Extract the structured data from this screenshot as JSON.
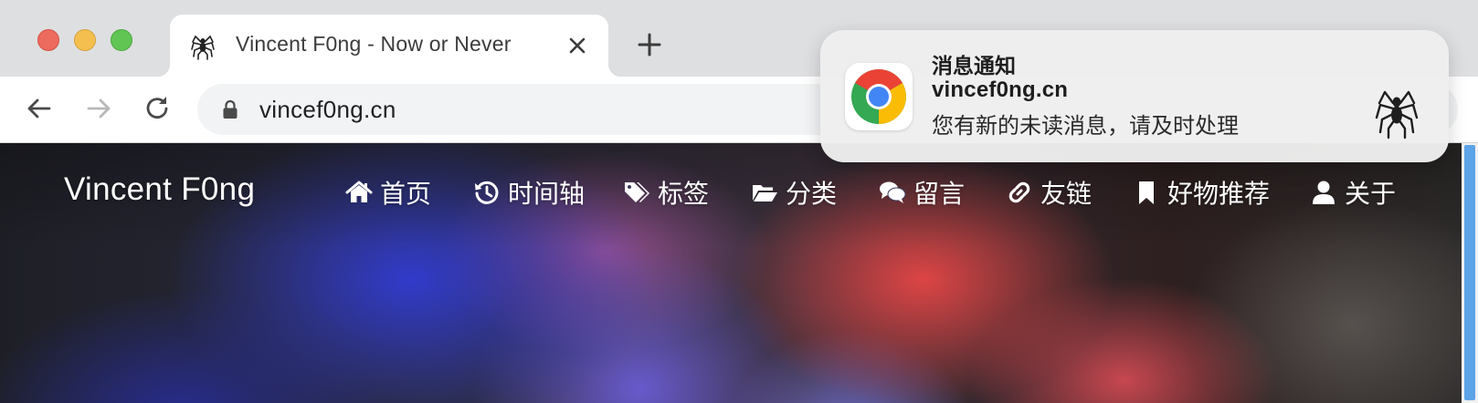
{
  "browser": {
    "tab": {
      "title": "Vincent F0ng - Now or Never",
      "favicon": "spider-icon"
    },
    "url": "vincef0ng.cn",
    "icons": {
      "back": "arrow-left-icon",
      "forward": "arrow-right-icon",
      "reload": "reload-icon",
      "lock": "lock-icon",
      "close": "close-icon",
      "new_tab": "plus-icon"
    }
  },
  "site": {
    "brand": "Vincent F0ng",
    "nav": [
      {
        "label": "首页",
        "icon": "home-icon"
      },
      {
        "label": "时间轴",
        "icon": "history-icon"
      },
      {
        "label": "标签",
        "icon": "tags-icon"
      },
      {
        "label": "分类",
        "icon": "folder-open-icon"
      },
      {
        "label": "留言",
        "icon": "comments-icon"
      },
      {
        "label": "友链",
        "icon": "link-icon"
      },
      {
        "label": "好物推荐",
        "icon": "bookmark-icon"
      },
      {
        "label": "关于",
        "icon": "user-icon"
      }
    ]
  },
  "notification": {
    "title": "消息通知",
    "site": "vincef0ng.cn",
    "body": "您有新的未读消息，请及时处理",
    "app_icon": "chrome-icon",
    "image_icon": "spider-icon"
  },
  "colors": {
    "titlebar": "#dedfe1",
    "omnibox": "#f1f3f4",
    "scroll_thumb": "#5da3e8",
    "traffic_close": "#ed6a5e",
    "traffic_minimize": "#f4bf4f",
    "traffic_zoom": "#61c554"
  }
}
